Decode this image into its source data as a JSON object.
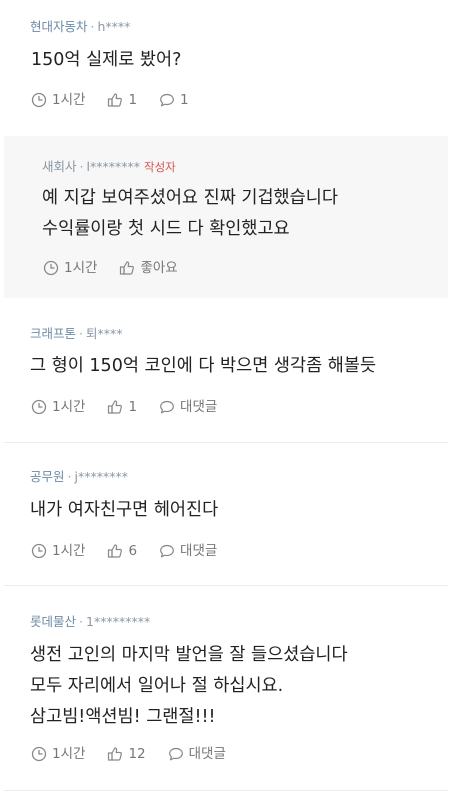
{
  "comments": [
    {
      "author": "현대자동차",
      "user": "h****",
      "lines": [
        "150억 실제로 봤어?"
      ],
      "time": "1시간",
      "likes": "1",
      "replies": "1"
    },
    {
      "author": "새회사",
      "user": "l********",
      "badge": "작성자",
      "lines": [
        "예 지갑 보여주셨어요 진짜 기겁했습니다",
        "수익률이랑 첫 시드 다 확인했고요"
      ],
      "time": "1시간",
      "likes": "좋아요"
    },
    {
      "author": "크래프톤",
      "user": "퇴****",
      "lines": [
        "그 형이 150억 코인에 다 박으면 생각좀 해볼듯"
      ],
      "time": "1시간",
      "likes": "1",
      "replies": "대댓글"
    },
    {
      "author": "공무원",
      "user": "j********",
      "lines": [
        "내가 여자친구면 헤어진다"
      ],
      "time": "1시간",
      "likes": "6",
      "replies": "대댓글"
    },
    {
      "author": "롯데물산",
      "user": "1*********",
      "lines": [
        "생전 고인의 마지막 발언을 잘 들으셨습니다",
        "모두 자리에서 일어나 절 하십시요.",
        "삼고빔!액션빔! 그랜절!!!"
      ],
      "time": "1시간",
      "likes": "12",
      "replies": "대댓글"
    }
  ]
}
